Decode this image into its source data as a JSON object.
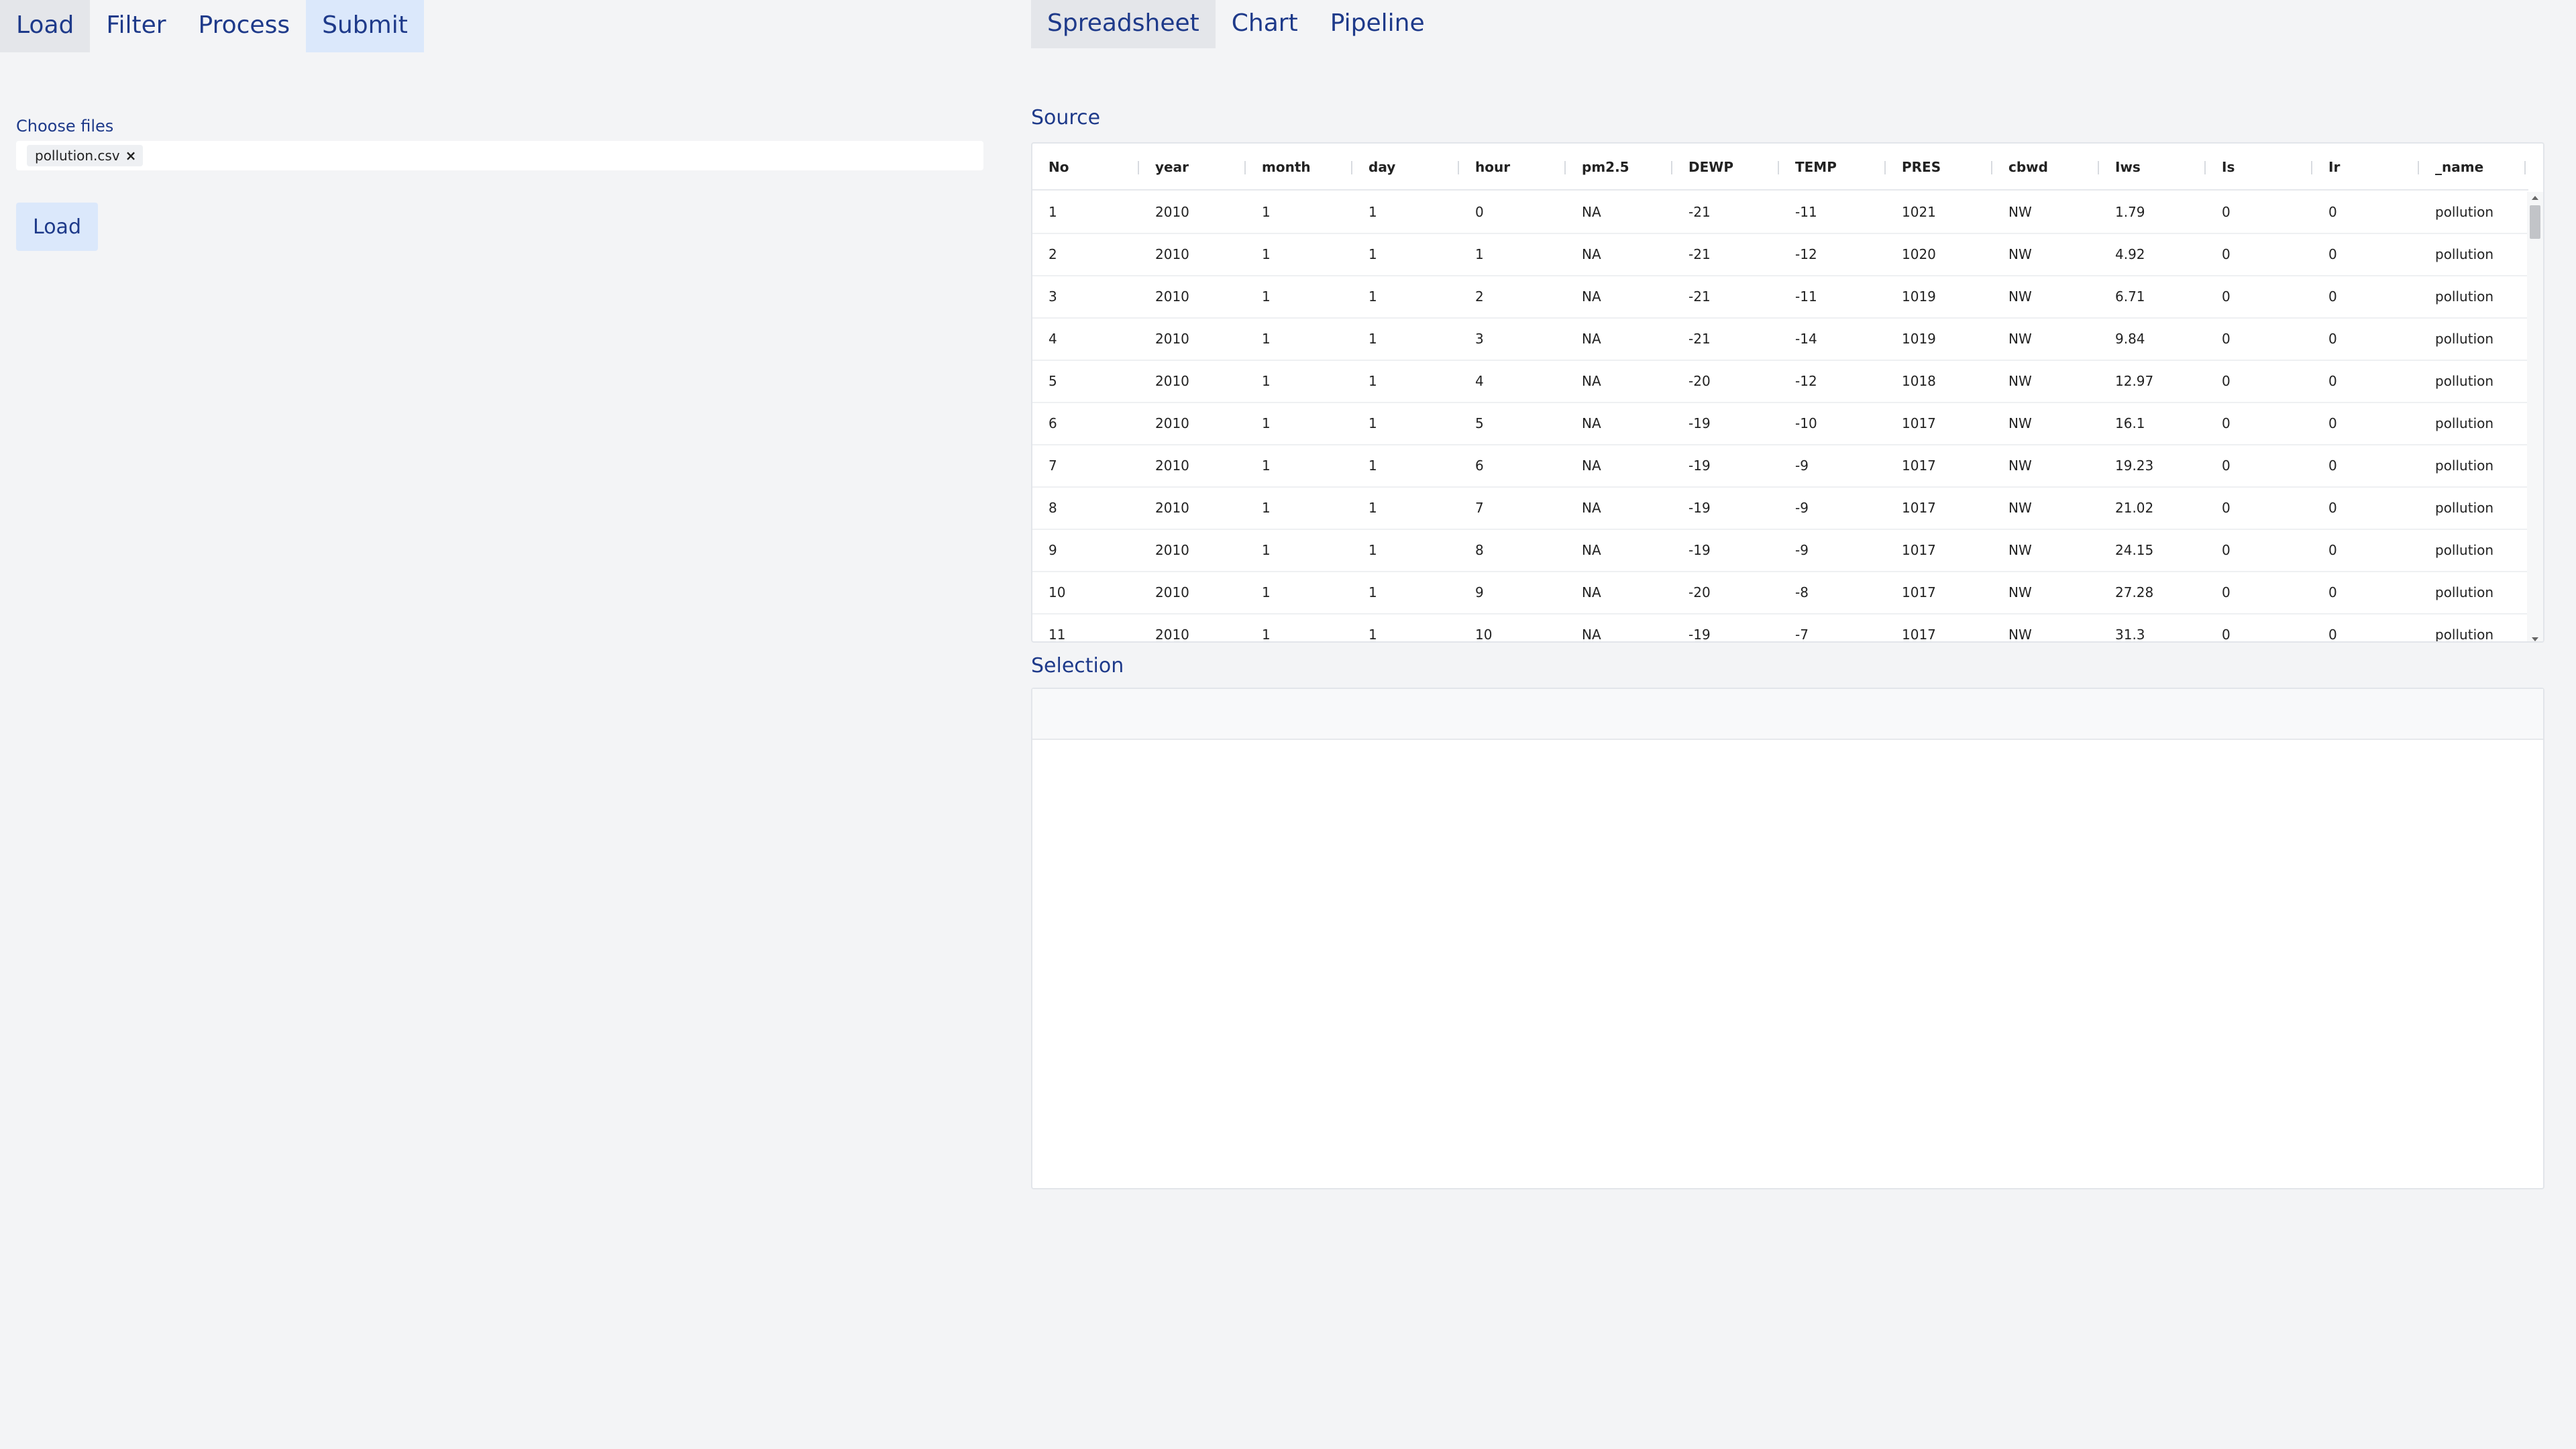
{
  "left_tabs": [
    {
      "label": "Load"
    },
    {
      "label": "Filter"
    },
    {
      "label": "Process"
    },
    {
      "label": "Submit"
    }
  ],
  "load_form": {
    "choose_files_label": "Choose files",
    "selected_file": "pollution.csv",
    "chip_close": "×",
    "load_button_label": "Load"
  },
  "right_tabs": [
    {
      "label": "Spreadsheet"
    },
    {
      "label": "Chart"
    },
    {
      "label": "Pipeline"
    }
  ],
  "source": {
    "title": "Source",
    "columns": [
      "No",
      "year",
      "month",
      "day",
      "hour",
      "pm2.5",
      "DEWP",
      "TEMP",
      "PRES",
      "cbwd",
      "Iws",
      "Is",
      "Ir",
      "_name"
    ],
    "rows": [
      [
        "1",
        "2010",
        "1",
        "1",
        "0",
        "NA",
        "-21",
        "-11",
        "1021",
        "NW",
        "1.79",
        "0",
        "0",
        "pollution"
      ],
      [
        "2",
        "2010",
        "1",
        "1",
        "1",
        "NA",
        "-21",
        "-12",
        "1020",
        "NW",
        "4.92",
        "0",
        "0",
        "pollution"
      ],
      [
        "3",
        "2010",
        "1",
        "1",
        "2",
        "NA",
        "-21",
        "-11",
        "1019",
        "NW",
        "6.71",
        "0",
        "0",
        "pollution"
      ],
      [
        "4",
        "2010",
        "1",
        "1",
        "3",
        "NA",
        "-21",
        "-14",
        "1019",
        "NW",
        "9.84",
        "0",
        "0",
        "pollution"
      ],
      [
        "5",
        "2010",
        "1",
        "1",
        "4",
        "NA",
        "-20",
        "-12",
        "1018",
        "NW",
        "12.97",
        "0",
        "0",
        "pollution"
      ],
      [
        "6",
        "2010",
        "1",
        "1",
        "5",
        "NA",
        "-19",
        "-10",
        "1017",
        "NW",
        "16.1",
        "0",
        "0",
        "pollution"
      ],
      [
        "7",
        "2010",
        "1",
        "1",
        "6",
        "NA",
        "-19",
        "-9",
        "1017",
        "NW",
        "19.23",
        "0",
        "0",
        "pollution"
      ],
      [
        "8",
        "2010",
        "1",
        "1",
        "7",
        "NA",
        "-19",
        "-9",
        "1017",
        "NW",
        "21.02",
        "0",
        "0",
        "pollution"
      ],
      [
        "9",
        "2010",
        "1",
        "1",
        "8",
        "NA",
        "-19",
        "-9",
        "1017",
        "NW",
        "24.15",
        "0",
        "0",
        "pollution"
      ],
      [
        "10",
        "2010",
        "1",
        "1",
        "9",
        "NA",
        "-20",
        "-8",
        "1017",
        "NW",
        "27.28",
        "0",
        "0",
        "pollution"
      ],
      [
        "11",
        "2010",
        "1",
        "1",
        "10",
        "NA",
        "-19",
        "-7",
        "1017",
        "NW",
        "31.3",
        "0",
        "0",
        "pollution"
      ]
    ]
  },
  "selection": {
    "title": "Selection"
  }
}
